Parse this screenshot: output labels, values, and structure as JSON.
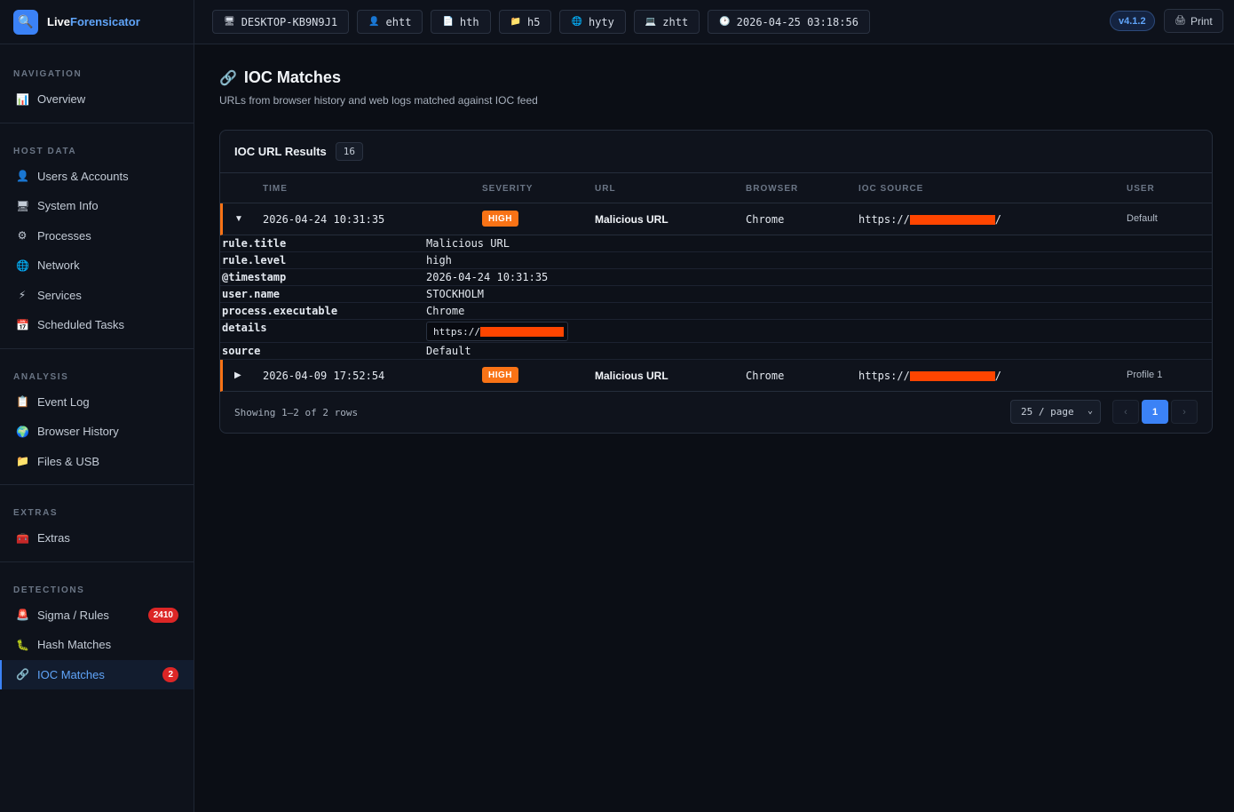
{
  "app": {
    "name_part1": "Live",
    "name_part2": "Forensicator",
    "version": "v4.1.2",
    "print_label": "Print"
  },
  "header_chips": [
    {
      "icon": "computer-icon",
      "glyph": "🖥",
      "label": "DESKTOP-KB9N9J1"
    },
    {
      "icon": "user-icon",
      "glyph": "👤",
      "label": "ehtt"
    },
    {
      "icon": "document-icon",
      "glyph": "📄",
      "label": "hth"
    },
    {
      "icon": "folder-icon",
      "glyph": "📁",
      "label": "h5"
    },
    {
      "icon": "globe-icon",
      "glyph": "🌐",
      "label": "hyty"
    },
    {
      "icon": "laptop-icon",
      "glyph": "💻",
      "label": "zhtt"
    },
    {
      "icon": "clock-icon",
      "glyph": "🕑",
      "label": "2026-04-25 03:18:56"
    }
  ],
  "sidebar": {
    "sections": [
      {
        "title": "NAVIGATION",
        "items": [
          {
            "label": "Overview",
            "icon": "chart-icon"
          }
        ]
      },
      {
        "title": "HOST DATA",
        "items": [
          {
            "label": "Users & Accounts",
            "icon": "user-icon"
          },
          {
            "label": "System Info",
            "icon": "computer-icon"
          },
          {
            "label": "Processes",
            "icon": "gear-icon"
          },
          {
            "label": "Network",
            "icon": "globe-icon"
          },
          {
            "label": "Services",
            "icon": "lightning-icon"
          },
          {
            "label": "Scheduled Tasks",
            "icon": "calendar-icon"
          }
        ]
      },
      {
        "title": "ANALYSIS",
        "items": [
          {
            "label": "Event Log",
            "icon": "notepad-icon"
          },
          {
            "label": "Browser History",
            "icon": "earth-icon"
          },
          {
            "label": "Files & USB",
            "icon": "folder-icon"
          }
        ]
      },
      {
        "title": "EXTRAS",
        "items": [
          {
            "label": "Extras",
            "icon": "toolbox-icon"
          }
        ]
      },
      {
        "title": "DETECTIONS",
        "items": [
          {
            "label": "Sigma / Rules",
            "icon": "siren-icon",
            "badge": "2410"
          },
          {
            "label": "Hash Matches",
            "icon": "bug-icon"
          },
          {
            "label": "IOC Matches",
            "icon": "link-icon",
            "badge": "2"
          }
        ]
      }
    ]
  },
  "page": {
    "title": "IOC Matches",
    "subtitle": "URLs from browser history and web logs matched against IOC feed"
  },
  "panel": {
    "title": "IOC URL Results",
    "count": "16",
    "columns": [
      "TIME",
      "SEVERITY",
      "URL",
      "BROWSER",
      "IOC SOURCE",
      "USER"
    ],
    "rows": [
      {
        "time": "2026-04-24 10:31:35",
        "severity": "HIGH",
        "url": "Malicious URL",
        "browser": "Chrome",
        "ioc_prefix": "https://",
        "ioc_suffix": "/",
        "user": "Default",
        "expanded": true
      },
      {
        "time": "2026-04-09 17:52:54",
        "severity": "HIGH",
        "url": "Malicious URL",
        "browser": "Chrome",
        "ioc_prefix": "https://",
        "ioc_suffix": "/",
        "user": "Profile 1",
        "expanded": false
      }
    ],
    "details": [
      {
        "key": "rule.title",
        "value": "Malicious URL"
      },
      {
        "key": "rule.level",
        "value": "high"
      },
      {
        "key": "@timestamp",
        "value": "2026-04-24 10:31:35"
      },
      {
        "key": "user.name",
        "value": "STOCKHOLM"
      },
      {
        "key": "process.executable",
        "value": "Chrome"
      },
      {
        "key": "details",
        "value": "https://"
      },
      {
        "key": "source",
        "value": "Default"
      }
    ],
    "footer": {
      "showing": "Showing 1–2 of 2 rows",
      "page_size": "25 / page",
      "prev": "‹",
      "current_page": "1",
      "next": "›"
    }
  },
  "colors": {
    "accent": "#3b82f6",
    "severity_high": "#f97316",
    "badge_red": "#dc2626",
    "redaction": "#ff4500"
  }
}
